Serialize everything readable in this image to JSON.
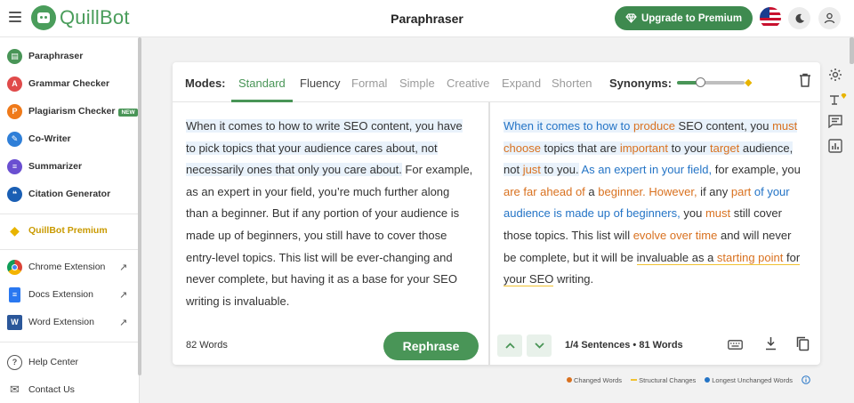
{
  "app": {
    "brand": "QuillBot",
    "page_title": "Paraphraser",
    "upgrade_label": "Upgrade to Premium"
  },
  "sidebar": {
    "items": [
      {
        "label": "Paraphraser",
        "icon": "paraphraser-icon",
        "color": "#499557"
      },
      {
        "label": "Grammar Checker",
        "icon": "grammar-icon",
        "color": "#e04b4b"
      },
      {
        "label": "Plagiarism Checker",
        "icon": "plagiarism-icon",
        "color": "#ef7a1a",
        "badge": "NEW"
      },
      {
        "label": "Co-Writer",
        "icon": "cowriter-icon",
        "color": "#2f7fd8"
      },
      {
        "label": "Summarizer",
        "icon": "summarizer-icon",
        "color": "#6a4fd1"
      },
      {
        "label": "Citation Generator",
        "icon": "citation-icon",
        "color": "#1a5fb4"
      }
    ],
    "premium_label": "QuillBot Premium",
    "extensions": [
      {
        "label": "Chrome Extension",
        "icon": "chrome-icon"
      },
      {
        "label": "Docs Extension",
        "icon": "docs-icon"
      },
      {
        "label": "Word Extension",
        "icon": "word-icon"
      }
    ],
    "footer": [
      {
        "label": "Help Center",
        "icon": "help-icon"
      },
      {
        "label": "Contact Us",
        "icon": "mail-icon"
      }
    ]
  },
  "toolbar": {
    "modes_label": "Modes:",
    "modes": [
      "Standard",
      "Fluency",
      "Formal",
      "Simple",
      "Creative",
      "Expand",
      "Shorten"
    ],
    "active_mode": "Standard",
    "synonyms_label": "Synonyms:",
    "synonyms_level": 0.33
  },
  "input": {
    "highlighted_text": "When it comes to how to write SEO content, you have to pick topics that your audience cares about, not necessarily ones that only you care about.",
    "rest_text": " For example, as an expert in your field, you’re much further along than a beginner. But if any portion of your audience is made up of beginners, you still have to cover those entry-level topics. This list will be ever-changing and never complete, but having it as a base for your SEO writing is invaluable.",
    "word_count": "82 Words",
    "rephrase_label": "Rephrase"
  },
  "output": {
    "segments": [
      {
        "text": "When it comes to how to ",
        "style": "blue hl"
      },
      {
        "text": "produce",
        "style": "orange hl"
      },
      {
        "text": " SEO content, you ",
        "style": "hl"
      },
      {
        "text": "must choose",
        "style": "orange hl"
      },
      {
        "text": " topics that are ",
        "style": "hl"
      },
      {
        "text": "important",
        "style": "orange hl"
      },
      {
        "text": " to your ",
        "style": "hl"
      },
      {
        "text": "target",
        "style": "orange hl"
      },
      {
        "text": " audience, not ",
        "style": "hl"
      },
      {
        "text": "just",
        "style": "orange hl"
      },
      {
        "text": " to you.",
        "style": "hl"
      },
      {
        "text": " As an expert in your field,",
        "style": "blue"
      },
      {
        "text": " for example, you ",
        "style": ""
      },
      {
        "text": "are far ahead of",
        "style": "orange"
      },
      {
        "text": " a ",
        "style": ""
      },
      {
        "text": "beginner. However,",
        "style": "orange"
      },
      {
        "text": " if any ",
        "style": ""
      },
      {
        "text": "part",
        "style": "orange"
      },
      {
        "text": " of your audience is made up of beginners,",
        "style": "blue"
      },
      {
        "text": " you ",
        "style": ""
      },
      {
        "text": "must",
        "style": "orange"
      },
      {
        "text": " still cover those topics. This list will ",
        "style": ""
      },
      {
        "text": "evolve over time",
        "style": "orange"
      },
      {
        "text": " and will never be complete, but it will be ",
        "style": ""
      },
      {
        "text": "invaluable as a ",
        "style": "yellow-ul"
      },
      {
        "text": "starting point",
        "style": "orange yellow-ul"
      },
      {
        "text": " for your SEO",
        "style": "yellow-ul"
      },
      {
        "text": " writing.",
        "style": ""
      }
    ],
    "sentence_info": "1/4 Sentences",
    "word_count": "81 Words"
  },
  "legend": {
    "changed": "Changed Words",
    "structural": "Structural Changes",
    "unchanged": "Longest Unchanged Words",
    "colors": {
      "changed": "#d9711f",
      "structural": "#f1c232",
      "unchanged": "#2474c6"
    }
  }
}
